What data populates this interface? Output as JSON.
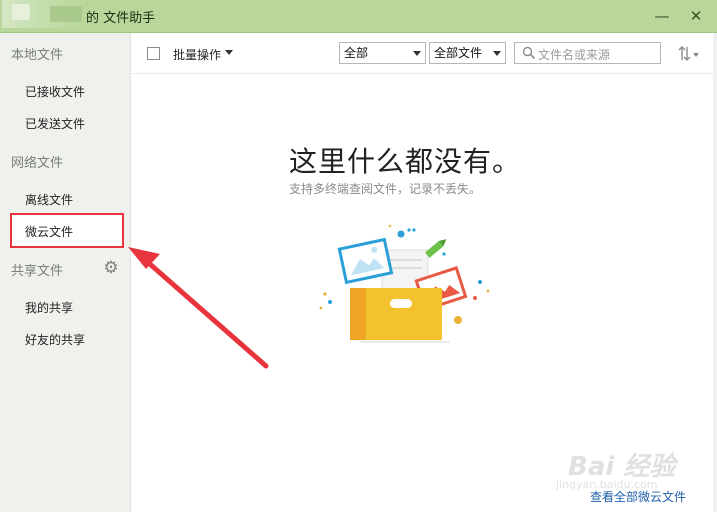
{
  "window": {
    "title": "的 文件助手",
    "minimize_glyph": "—",
    "close_glyph": "✕"
  },
  "sidebar": {
    "sections": [
      {
        "title": "本地文件",
        "items": [
          "已接收文件",
          "已发送文件"
        ]
      },
      {
        "title": "网络文件",
        "items": [
          "离线文件",
          "微云文件"
        ]
      },
      {
        "title": "共享文件",
        "items": [
          "我的共享",
          "好友的共享"
        ]
      }
    ],
    "selected_item": "微云文件"
  },
  "toolbar": {
    "batch_label": "批量操作",
    "filter_1": "全部",
    "filter_2": "全部文件",
    "search_placeholder": "文件名或来源"
  },
  "empty_state": {
    "title": "这里什么都没有。",
    "subtitle": "支持多终端查阅文件，记录不丢失。"
  },
  "footer": {
    "link": "查看全部微云文件"
  },
  "watermark": {
    "text": "Bai 经验",
    "sub": "jingyan.baidu.com"
  },
  "colors": {
    "annotation": "#e8343c",
    "titlebar": "#b9d79a",
    "link": "#1f5ea8"
  }
}
